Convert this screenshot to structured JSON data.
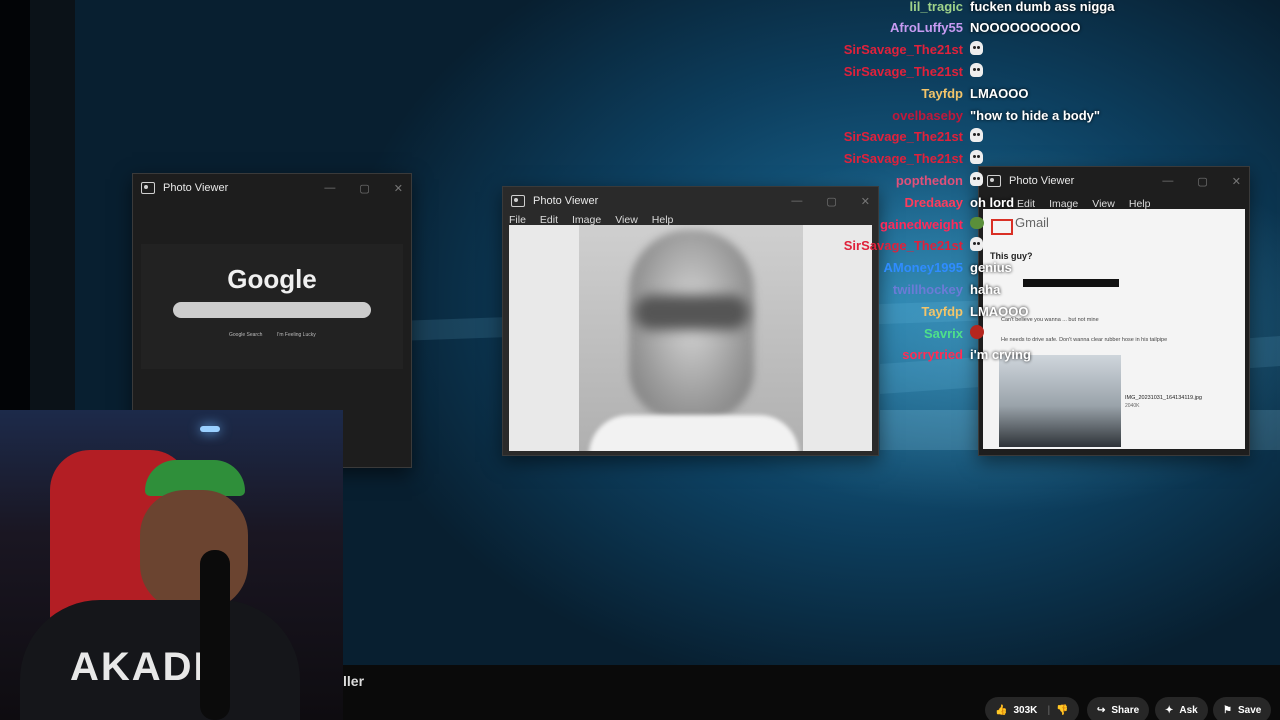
{
  "chat": [
    {
      "user": "lil_tragic",
      "color": "#9fd38a",
      "message": "fucken dumb ass nigga",
      "emote": ""
    },
    {
      "user": "AfroLuffy55",
      "color": "#c79bf2",
      "message": "NOOOOOOOOOO",
      "emote": ""
    },
    {
      "user": "SirSavage_The21st",
      "color": "#e0213b",
      "message": "",
      "emote": "skull"
    },
    {
      "user": "SirSavage_The21st",
      "color": "#e0213b",
      "message": "",
      "emote": "skull"
    },
    {
      "user": "Tayfdp",
      "color": "#f2c46a",
      "message": "LMAOOO",
      "emote": ""
    },
    {
      "user": "ovelbaseby",
      "color": "#c0183a",
      "message": "\"how to hide a body\"",
      "emote": ""
    },
    {
      "user": "SirSavage_The21st",
      "color": "#e0213b",
      "message": "",
      "emote": "skull"
    },
    {
      "user": "SirSavage_The21st",
      "color": "#e0213b",
      "message": "",
      "emote": "skull"
    },
    {
      "user": "popthedon",
      "color": "#e0507a",
      "message": "",
      "emote": "skull"
    },
    {
      "user": "Dredaaay",
      "color": "#ff3b5c",
      "message": "oh lord",
      "emote": ""
    },
    {
      "user": "gainedweight",
      "color": "#ff2a5a",
      "message": "",
      "emote": "pepe"
    },
    {
      "user": "SirSavage_The21st",
      "color": "#e0213b",
      "message": "",
      "emote": "skull"
    },
    {
      "user": "AMoney1995",
      "color": "#2f8cff",
      "message": "genius",
      "emote": ""
    },
    {
      "user": "twillhockey",
      "color": "#6b7bd6",
      "message": "haha",
      "emote": ""
    },
    {
      "user": "Tayfdp",
      "color": "#f2c46a",
      "message": "LMAOOO",
      "emote": ""
    },
    {
      "user": "Savrix",
      "color": "#4ee08a",
      "message": "",
      "emote": "devil"
    },
    {
      "user": "sorrytried",
      "color": "#ff2d55",
      "message": "i'm crying",
      "emote": ""
    }
  ],
  "windows": {
    "left": {
      "title": "Photo Viewer",
      "google_logo": "Google",
      "btn1": "Google Search",
      "btn2": "I'm Feeling Lucky"
    },
    "center": {
      "title": "Photo Viewer",
      "menu": [
        "File",
        "Edit",
        "Image",
        "View",
        "Help"
      ]
    },
    "right": {
      "title": "Photo Viewer",
      "menu": [
        "Edit",
        "Image",
        "View",
        "Help"
      ],
      "gmail": "Gmail",
      "subject": "This guy?",
      "line1": "Can't believe you wanna ... but not mine",
      "line2": "He needs to drive safe. Don't wanna clear rubber hose in his tailpipe",
      "attachment_name": "IMG_20231031_164134119.jpg",
      "attachment_size": "2040K"
    }
  },
  "video_title_fragment": "ller",
  "actions": {
    "likes": "303K",
    "share": "Share",
    "ask": "Ask",
    "save": "Save"
  }
}
